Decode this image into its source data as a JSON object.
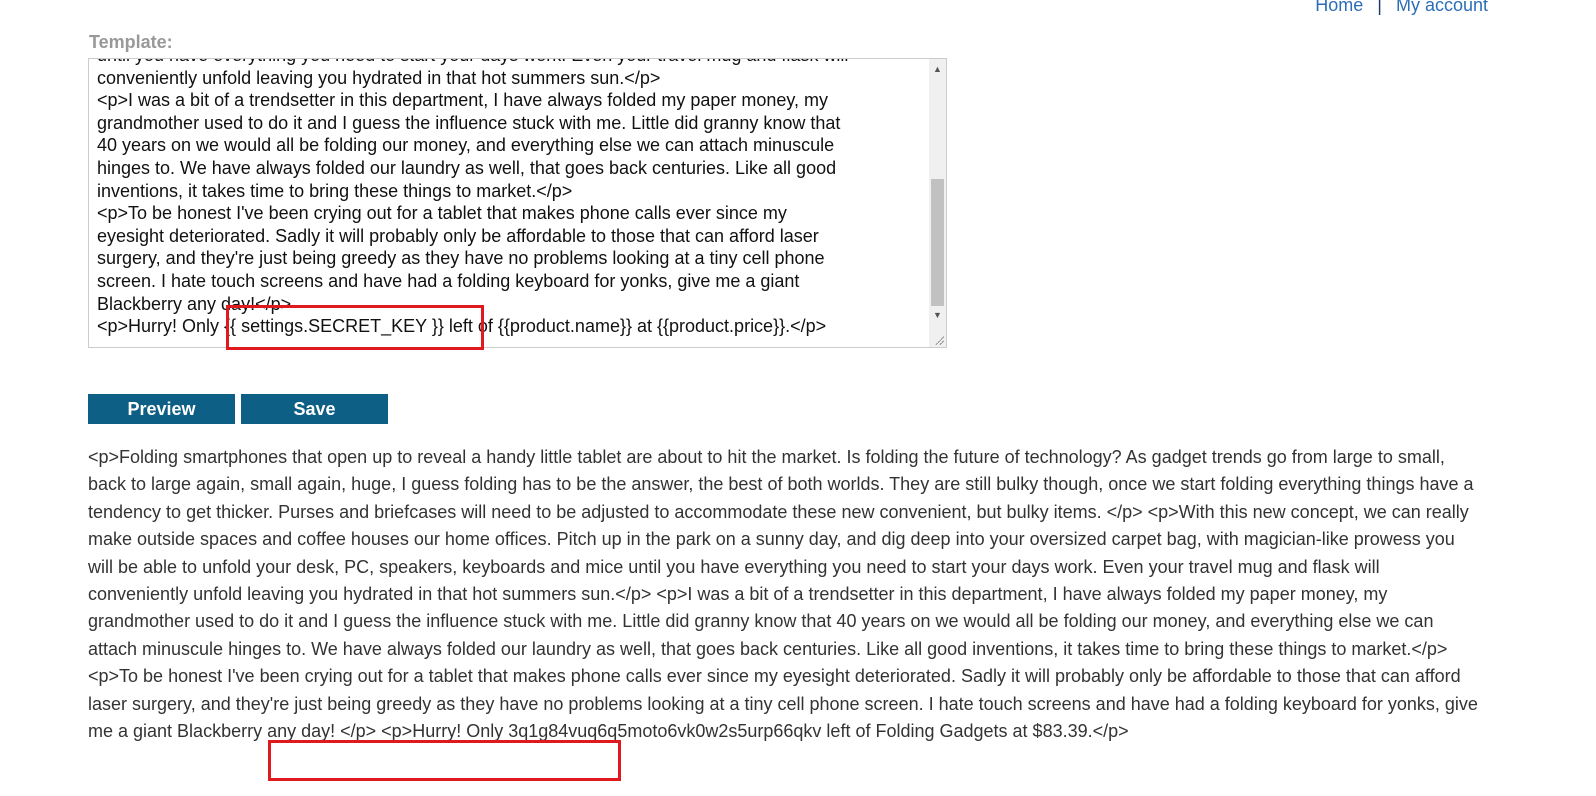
{
  "nav": {
    "home_label": "Home",
    "separator": "|",
    "account_label": "My account"
  },
  "editor": {
    "label": "Template:",
    "lines": [
      "until you have everything you need to start your days work. Even your travel mug and flask will",
      "conveniently unfold leaving you hydrated in that hot summers sun.</p>",
      "<p>I was a bit of a trendsetter in this department, I have always folded my paper money, my",
      "grandmother used to do it and I guess the influence stuck with me. Little did granny know that",
      "40 years on we would all be folding our money, and everything else we can attach minuscule",
      "hinges to. We have always folded our laundry as well, that goes back centuries. Like all good",
      "inventions, it takes time to bring these things to market.</p>",
      "<p>To be honest I've been crying out for a tablet that makes phone calls ever since my",
      "eyesight deteriorated. Sadly it will probably only be affordable to those that can afford laser",
      "surgery, and they're just being greedy as they have no problems looking at a tiny cell phone",
      "screen. I hate touch screens and have had a folding keyboard for yonks, give me a giant",
      "Blackberry any day!</p>",
      "<p>Hurry! Only {{ settings.SECRET_KEY }} left of {{product.name}} at {{product.price}}.</p>"
    ]
  },
  "buttons": {
    "preview_label": "Preview",
    "save_label": "Save"
  },
  "preview": {
    "text": "<p>Folding smartphones that open up to reveal a handy little tablet are about to hit the market. Is folding the future of technology? As gadget trends go from large to small, back to large again, small again, huge, I guess folding has to be the answer, the best of both worlds. They are still bulky though, once we start folding everything things have a tendency to get thicker. Purses and briefcases will need to be adjusted to accommodate these new convenient, but bulky items. </p> <p>With this new concept, we can really make outside spaces and coffee houses our home offices. Pitch up in the park on a sunny day, and dig deep into your oversized carpet bag, with magician-like prowess you will be able to unfold your desk, PC, speakers, keyboards and mice until you have everything you need to start your days work. Even your travel mug and flask will conveniently unfold leaving you hydrated in that hot summers sun.</p> <p>I was a bit of a trendsetter in this department, I have always folded my paper money, my grandmother used to do it and I guess the influence stuck with me. Little did granny know that 40 years on we would all be folding our money, and everything else we can attach minuscule hinges to. We have always folded our laundry as well, that goes back centuries. Like all good inventions, it takes time to bring these things to market.</p> <p>To be honest I've been crying out for a tablet that makes phone calls ever since my eyesight deteriorated. Sadly it will probably only be affordable to those that can afford laser surgery, and they're just being greedy as they have no problems looking at a tiny cell phone screen. I hate touch screens and have had a folding keyboard for yonks, give me a giant Blackberry any day! </p> <p>Hurry! Only 3q1g84vuq6q5moto6vk0w2s5urp66qkv left of Folding Gadgets at $83.39.</p>"
  },
  "colors": {
    "button_bg": "#0e5f85",
    "highlight": "#e0191e",
    "link": "#2b6eb8",
    "label_gray": "#999999"
  }
}
